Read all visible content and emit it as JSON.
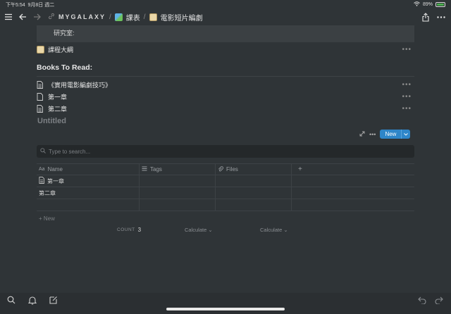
{
  "status": {
    "time": "下午5:54",
    "date": "9月8日 週二",
    "battery": "89%"
  },
  "nav": {
    "workspace": "MYGALAXY",
    "crumb1": "課表",
    "crumb2": "電影短片編劇",
    "sep": "/"
  },
  "page": {
    "lab_text": "研究室:",
    "outline_label": "課程大綱",
    "books_heading": "Books To Read:",
    "books": [
      "《實用電影編劇技巧》",
      "第一章",
      "第二章"
    ],
    "untitled": "Untitled",
    "dots": "•••"
  },
  "database": {
    "new_label": "New",
    "search_placeholder": "Type to search...",
    "columns": {
      "name": "Name",
      "tags": "Tags",
      "files": "Files",
      "add": "+"
    },
    "rows": [
      {
        "name": "第一章",
        "tags": "",
        "files": ""
      },
      {
        "name": "第二章",
        "tags": "",
        "files": ""
      },
      {
        "name": "",
        "tags": "",
        "files": ""
      }
    ],
    "add_row": "+ New",
    "count_label": "COUNT",
    "count_value": "3",
    "calc1": "Calculate ⌄",
    "calc2": "Calculate ⌄"
  },
  "colors": {
    "background": "#2f3437",
    "accent": "#2e86c9"
  }
}
